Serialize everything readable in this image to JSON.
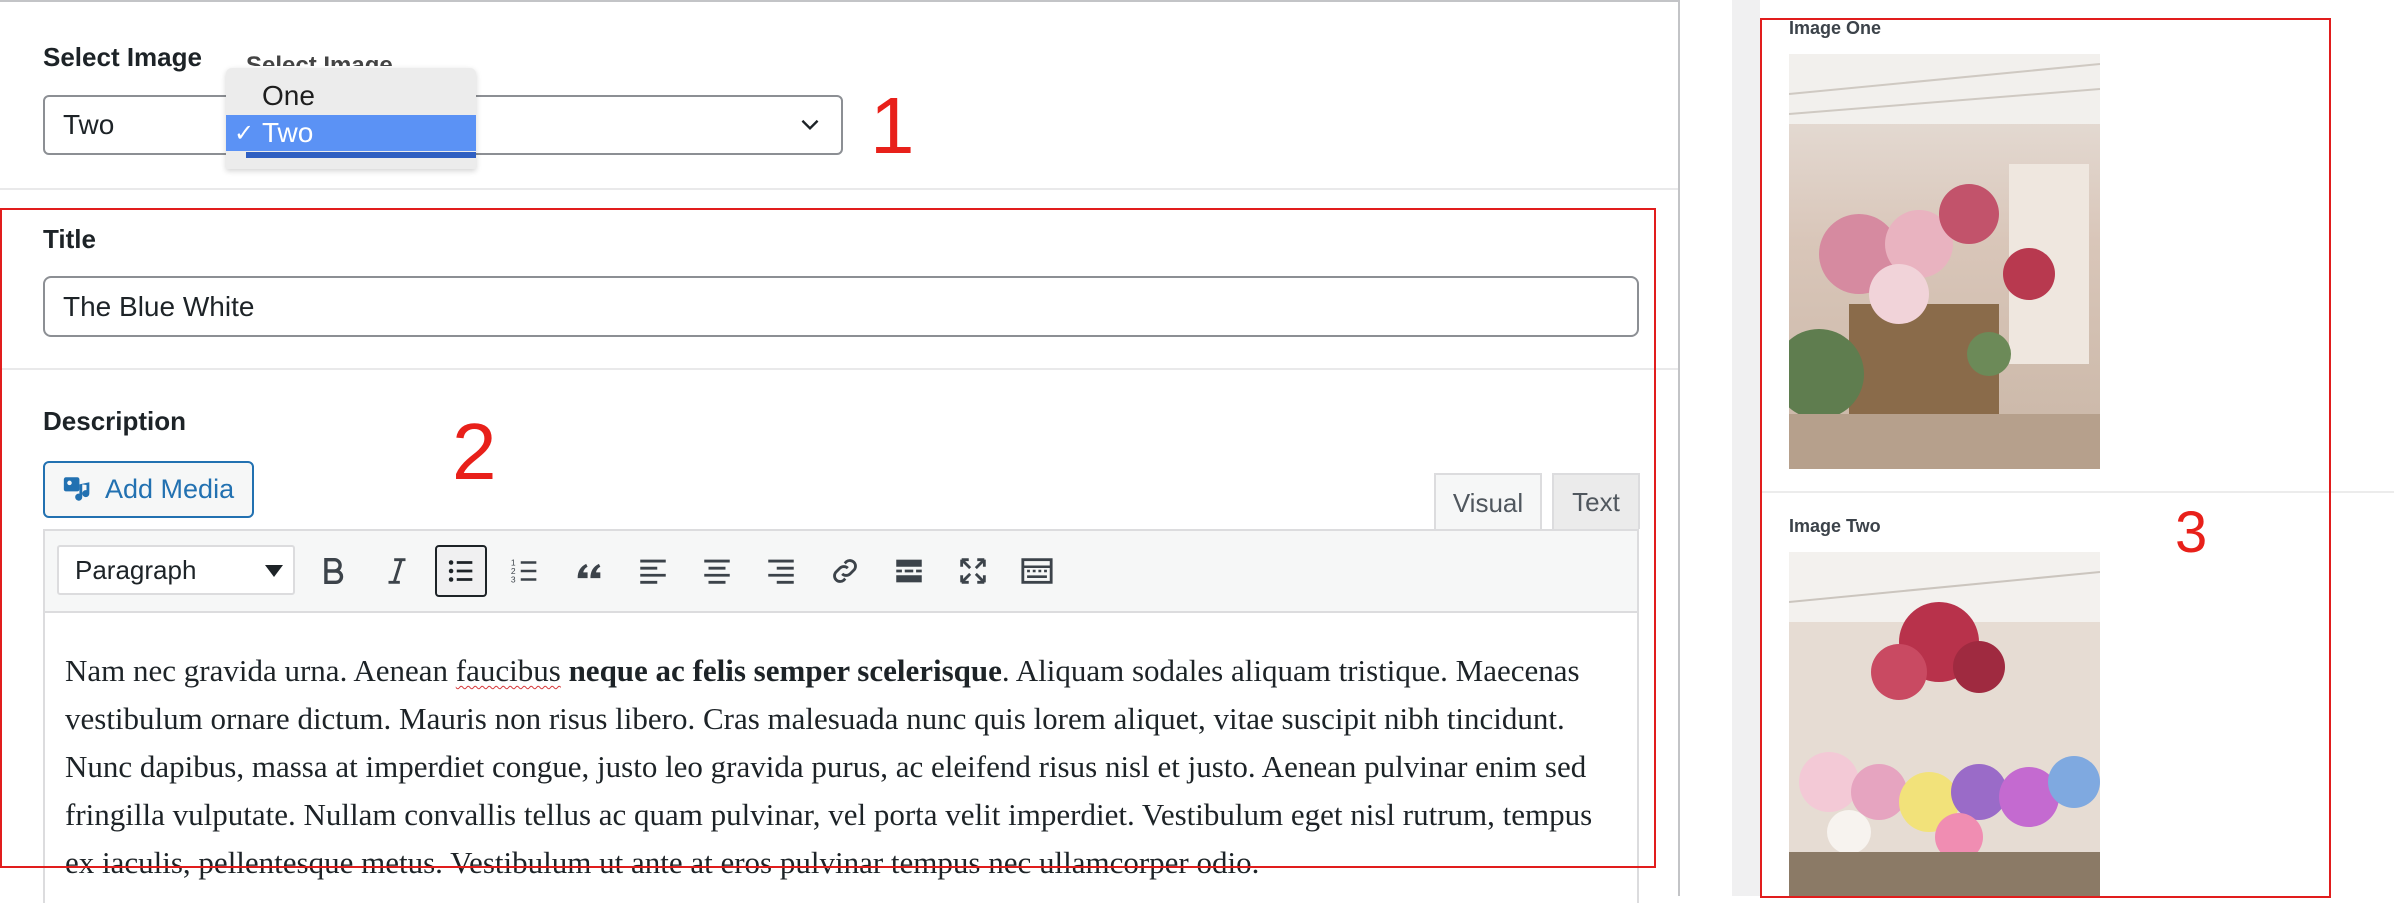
{
  "select_image": {
    "label": "Select Image",
    "value": "Two",
    "popup_heading": "Select Image",
    "options": [
      "One",
      "Two"
    ],
    "selected_option": "Two",
    "check_mark": "✓"
  },
  "title_field": {
    "label": "Title",
    "value": "The Blue White"
  },
  "description": {
    "label": "Description",
    "add_media_label": "Add Media",
    "tabs": {
      "visual": "Visual",
      "text": "Text"
    },
    "format_select": "Paragraph",
    "content_parts": {
      "p1": "Nam nec gravida urna. Aenean ",
      "misspelled": "faucibus",
      "p2": " ",
      "bold": "neque ac felis semper scelerisque",
      "p3": ". Aliquam sodales aliquam tristique. Maecenas vestibulum ornare dictum. Mauris non risus libero. Cras malesuada nunc quis lorem aliquet, vitae suscipit nibh tincidunt. Nunc dapibus, massa at imperdiet congue, justo leo gravida purus, ac eleifend risus nisl et justo. Aenean pulvinar enim sed fringilla vulputate. Nullam convallis tellus ac quam pulvinar, vel porta velit imperdiet. Vestibulum eget nisl rutrum, tempus ex iaculis, pellentesque metus. Vestibulum ut ante at eros pulvinar tempus nec ullamcorper odio."
    }
  },
  "annotations": {
    "one": "1",
    "two": "2",
    "three": "3"
  },
  "preview": {
    "image_one_label": "Image One",
    "image_two_label": "Image Two"
  },
  "colors": {
    "annotation_red": "#e11d1d",
    "accent_blue": "#2271b1",
    "dropdown_highlight": "#5b92f5"
  }
}
